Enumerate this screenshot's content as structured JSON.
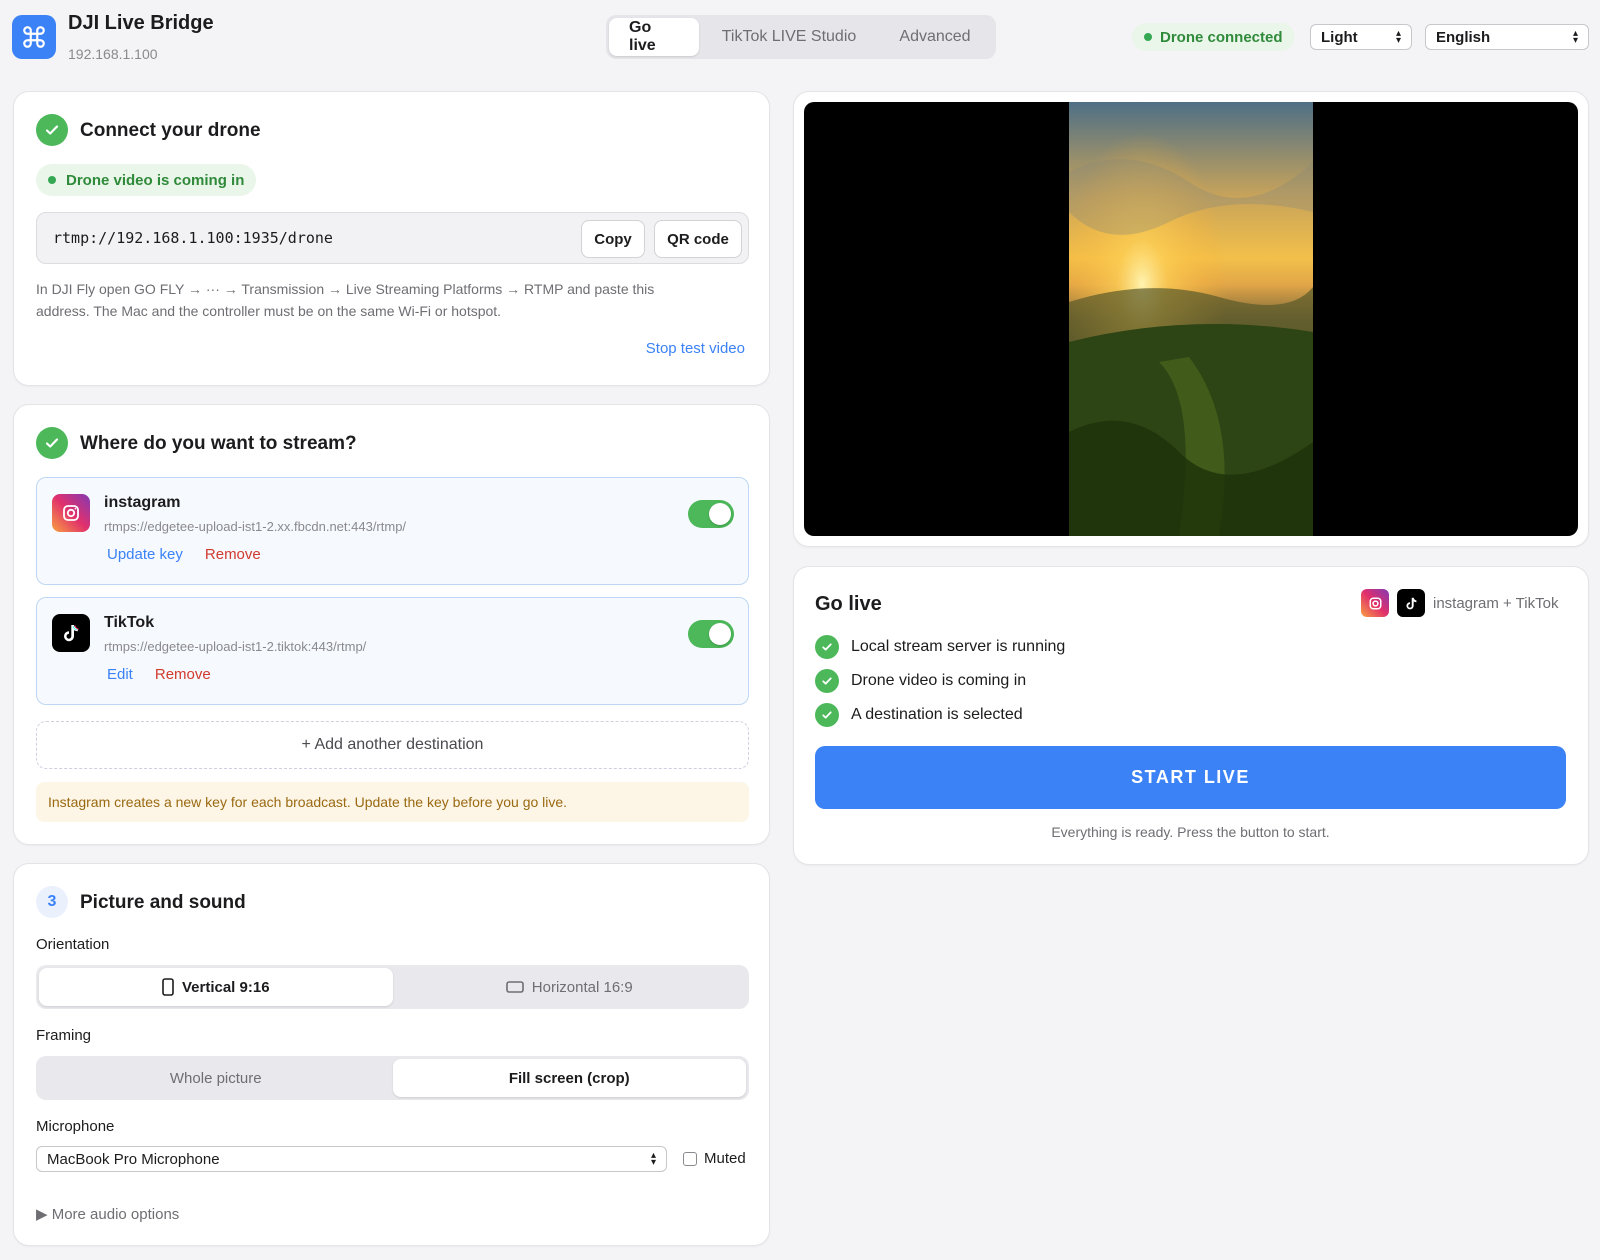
{
  "app": {
    "title": "DJI Live Bridge",
    "ip": "192.168.1.100",
    "accent_color": "#3b82f6"
  },
  "tabs": [
    {
      "label": "Go live",
      "active": true
    },
    {
      "label": "TikTok LIVE Studio",
      "active": false
    },
    {
      "label": "Advanced",
      "active": false
    }
  ],
  "header": {
    "status": "Drone connected",
    "theme": "Light",
    "language": "English"
  },
  "connect": {
    "title": "Connect your drone",
    "video_status": "Drone video is coming in",
    "rtmp_url": "rtmp://192.168.1.100:1935/drone",
    "copy_label": "Copy",
    "qr_label": "QR code",
    "help_line1": "In DJI Fly open GO FLY → ··· → Transmission → Live Streaming Platforms → RTMP and paste this",
    "help_line2": "address. The Mac and the controller must be on the same Wi-Fi or hotspot.",
    "stop_test": "Stop test video"
  },
  "destinations": {
    "title": "Where do you want to stream?",
    "items": [
      {
        "name": "instagram",
        "url": "rtmps://edgetee-upload-ist1-2.xx.fbcdn.net:443/rtmp/",
        "primary_action": "Update key",
        "remove": "Remove",
        "enabled": true
      },
      {
        "name": "TikTok",
        "url": "rtmps://edgetee-upload-ist1-2.tiktok:443/rtmp/",
        "primary_action": "Edit",
        "remove": "Remove",
        "enabled": true
      }
    ],
    "add_label": "+ Add another destination",
    "warning": "Instagram creates a new key for each broadcast. Update the key before you go live."
  },
  "picture": {
    "step": "3",
    "title": "Picture and sound",
    "orientation_label": "Orientation",
    "orientation_options": [
      "Vertical 9:16",
      "Horizontal 16:9"
    ],
    "orientation_selected": "Vertical 9:16",
    "framing_label": "Framing",
    "framing_options": [
      "Whole picture",
      "Fill screen (crop)"
    ],
    "framing_selected": "Fill screen (crop)",
    "microphone_label": "Microphone",
    "microphone": "MacBook Pro Microphone",
    "muted_label": "Muted",
    "muted": false,
    "more_audio": "▶ More audio options"
  },
  "golive": {
    "title": "Go live",
    "targets": "instagram + TikTok",
    "checks": [
      "Local stream server is running",
      "Drone video is coming in",
      "A destination is selected"
    ],
    "start_label": "START LIVE",
    "ready_text": "Everything is ready. Press the button to start."
  }
}
